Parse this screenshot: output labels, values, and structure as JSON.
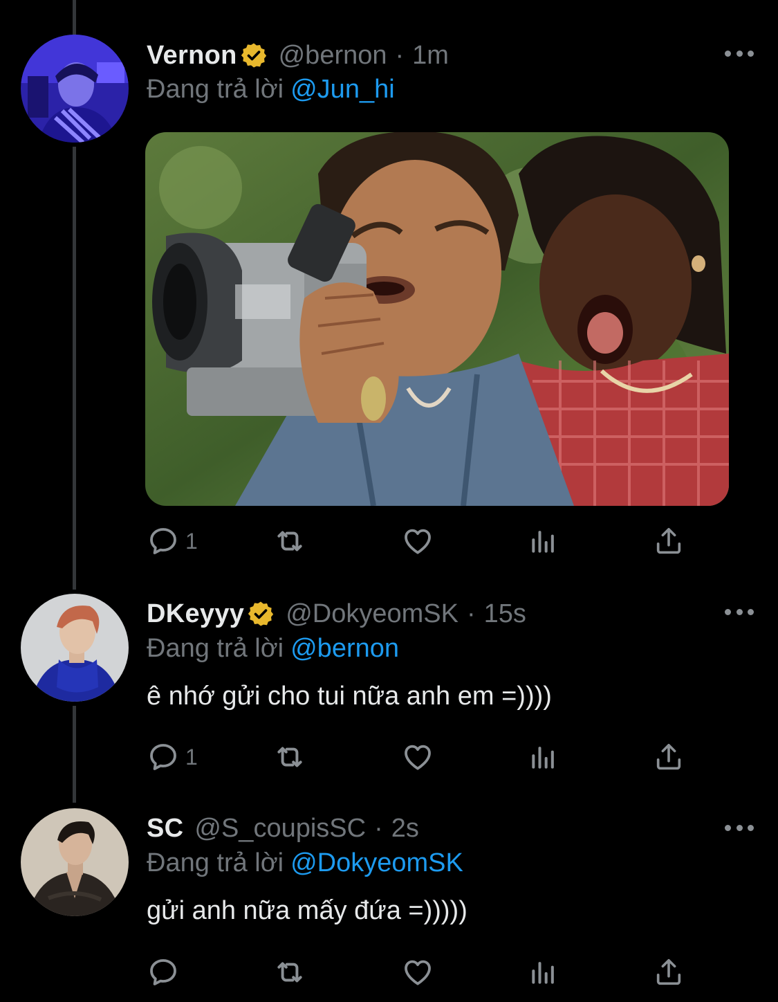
{
  "tweets": [
    {
      "name": "Vernon",
      "verified": true,
      "handle": "@bernon",
      "separator": "·",
      "time": "1m",
      "reply_prefix": "Đang trả lời",
      "reply_to": "@Jun_hi",
      "text": "",
      "has_media": true,
      "reply_count": "1"
    },
    {
      "name": "DKeyyy",
      "verified": true,
      "handle": "@DokyeomSK",
      "separator": "·",
      "time": "15s",
      "reply_prefix": "Đang trả lời",
      "reply_to": "@bernon",
      "text": "ê nhớ gửi cho tui nữa anh em =))))",
      "has_media": false,
      "reply_count": "1"
    },
    {
      "name": "SC",
      "verified": false,
      "handle": "@S_coupisSC",
      "separator": "·",
      "time": "2s",
      "reply_prefix": "Đang trả lời",
      "reply_to": "@DokyeomSK",
      "text": "gửi anh nữa mấy đứa =)))))",
      "has_media": false,
      "reply_count": ""
    }
  ],
  "colors": {
    "background": "#000000",
    "primary_text": "#e7e9ea",
    "secondary_text": "#71767b",
    "link": "#1d9bf0",
    "verified_badge": "#e8b82d"
  },
  "icons": [
    "reply-icon",
    "retweet-icon",
    "like-icon",
    "views-icon",
    "share-icon",
    "more-icon",
    "verified-badge-icon"
  ]
}
